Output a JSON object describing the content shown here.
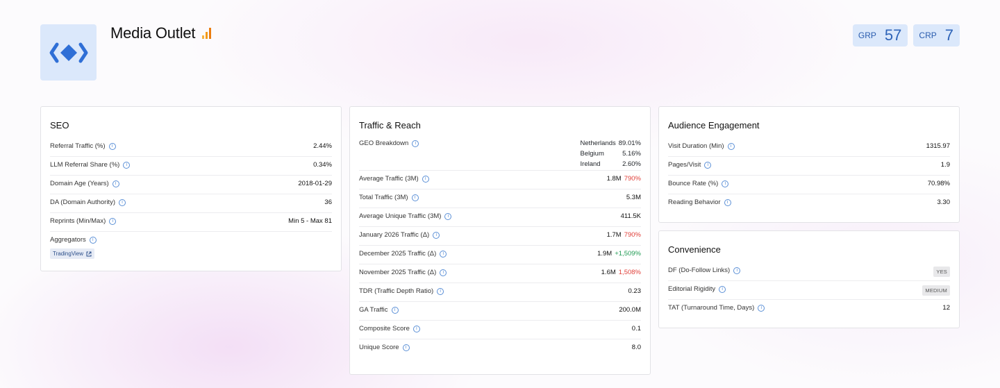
{
  "header": {
    "title": "Media Outlet",
    "logo_icon": "diamond-brackets-icon",
    "analytics_icon": "bar-chart-icon",
    "badges": [
      {
        "label": "GRP",
        "value": "57"
      },
      {
        "label": "CRP",
        "value": "7"
      }
    ]
  },
  "seo": {
    "title": "SEO",
    "rows": [
      {
        "label": "Referral Traffic (%)",
        "value": "2.44%"
      },
      {
        "label": "LLM Referral Share (%)",
        "value": "0.34%"
      },
      {
        "label": "Domain Age (Years)",
        "value": "2018-01-29"
      },
      {
        "label": "DA (Domain Authority)",
        "value": "36"
      },
      {
        "label": "Reprints (Min/Max)",
        "value": "Min 5 - Max 81"
      }
    ],
    "aggregators_label": "Aggregators",
    "aggregator_tag": "TradingView"
  },
  "traffic": {
    "title": "Traffic & Reach",
    "geo_label": "GEO Breakdown",
    "geo": [
      {
        "country": "Netherlands",
        "pct": "89.01%"
      },
      {
        "country": "Belgium",
        "pct": "5.16%"
      },
      {
        "country": "Ireland",
        "pct": "2.60%"
      }
    ],
    "rows": [
      {
        "label": "Average Traffic (3M)",
        "value": "1.8M",
        "delta": "790%",
        "delta_color": "red"
      },
      {
        "label": "Total Traffic (3M)",
        "value": "5.3M"
      },
      {
        "label": "Average Unique Traffic (3M)",
        "value": "411.5K"
      },
      {
        "label": "January 2026 Traffic (Δ)",
        "value": "1.7M",
        "delta": "790%",
        "delta_color": "red"
      },
      {
        "label": "December 2025 Traffic (Δ)",
        "value": "1.9M",
        "delta": "+1,509%",
        "delta_color": "green"
      },
      {
        "label": "November 2025 Traffic (Δ)",
        "value": "1.6M",
        "delta": "1,508%",
        "delta_color": "red"
      },
      {
        "label": "TDR (Traffic Depth Ratio)",
        "value": "0.23"
      },
      {
        "label": "GA Traffic",
        "value": "200.0M"
      },
      {
        "label": "Composite Score",
        "value": "0.1"
      },
      {
        "label": "Unique Score",
        "value": "8.0"
      }
    ]
  },
  "engagement": {
    "title": "Audience Engagement",
    "rows": [
      {
        "label": "Visit Duration (Min)",
        "value": "1315.97"
      },
      {
        "label": "Pages/Visit",
        "value": "1.9"
      },
      {
        "label": "Bounce Rate (%)",
        "value": "70.98%"
      },
      {
        "label": "Reading Behavior",
        "value": "3.30"
      }
    ]
  },
  "convenience": {
    "title": "Convenience",
    "rows": [
      {
        "label": "DF (Do-Follow Links)",
        "value": "YES"
      },
      {
        "label": "Editorial Rigidity",
        "value": "MEDIUM"
      },
      {
        "label": "TAT (Turnaround Time, Days)",
        "value": "12"
      }
    ]
  },
  "colors": {
    "accent": "#2d63b8",
    "badge_bg": "#dbe8fb",
    "positive": "#1f9a53",
    "negative": "#e0403a",
    "analytics_orange": "#f29a1a"
  }
}
